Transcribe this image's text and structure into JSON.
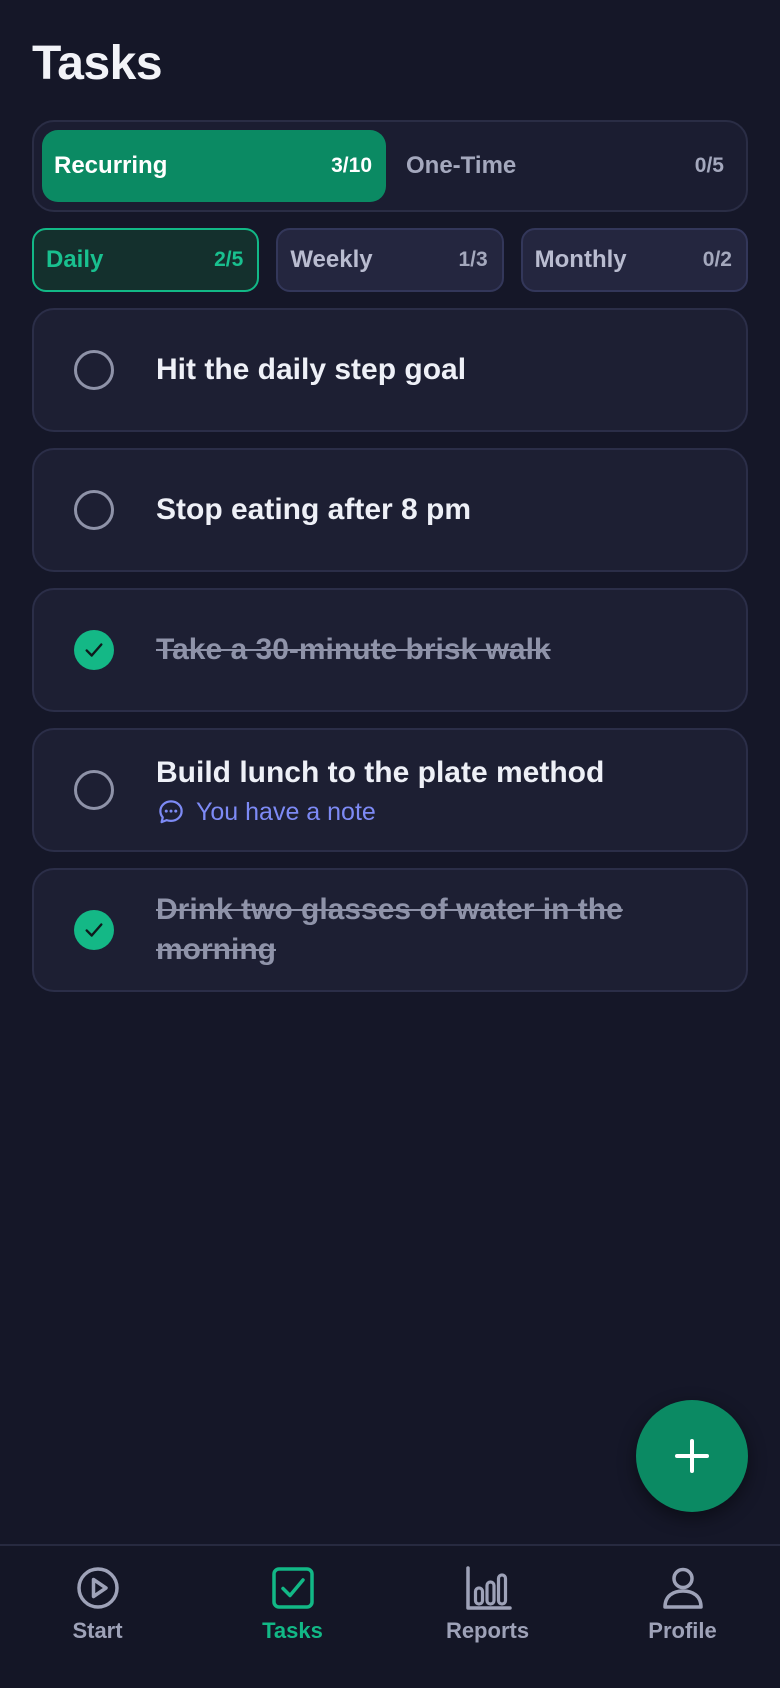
{
  "page": {
    "title": "Tasks"
  },
  "segments": [
    {
      "label": "Recurring",
      "count": "3/10",
      "active": true
    },
    {
      "label": "One-Time",
      "count": "0/5",
      "active": false
    }
  ],
  "filters": [
    {
      "label": "Daily",
      "count": "2/5",
      "active": true
    },
    {
      "label": "Weekly",
      "count": "1/3",
      "active": false
    },
    {
      "label": "Monthly",
      "count": "0/2",
      "active": false
    }
  ],
  "tasks": [
    {
      "text": "Hit the daily step goal",
      "done": false
    },
    {
      "text": "Stop eating after 8 pm",
      "done": false
    },
    {
      "text": "Take a 30-minute brisk walk",
      "done": true
    },
    {
      "text": "Build lunch to the plate method",
      "done": false,
      "note": "You have a note"
    },
    {
      "text": "Drink two glasses of water in the morning",
      "done": true
    }
  ],
  "fab": {
    "icon": "plus-icon"
  },
  "nav": [
    {
      "label": "Start",
      "icon": "play-circle-icon",
      "active": false
    },
    {
      "label": "Tasks",
      "icon": "check-square-icon",
      "active": true
    },
    {
      "label": "Reports",
      "icon": "bar-chart-icon",
      "active": false
    },
    {
      "label": "Profile",
      "icon": "user-icon",
      "active": false
    }
  ],
  "colors": {
    "background": "#151728",
    "accent": "#0b8a63",
    "accent_bright": "#12b886",
    "note": "#7d8af5"
  }
}
